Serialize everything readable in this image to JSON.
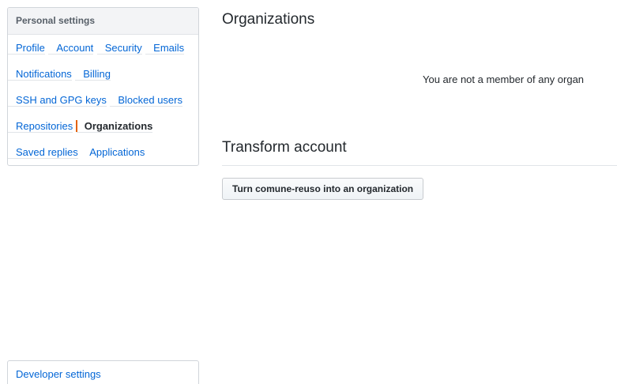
{
  "sidebar": {
    "heading": "Personal settings",
    "items": [
      {
        "label": "Profile",
        "selected": false
      },
      {
        "label": "Account",
        "selected": false
      },
      {
        "label": "Security",
        "selected": false
      },
      {
        "label": "Emails",
        "selected": false
      },
      {
        "label": "Notifications",
        "selected": false
      },
      {
        "label": "Billing",
        "selected": false
      },
      {
        "label": "SSH and GPG keys",
        "selected": false
      },
      {
        "label": "Blocked users",
        "selected": false
      },
      {
        "label": "Repositories",
        "selected": false
      },
      {
        "label": "Organizations",
        "selected": true
      },
      {
        "label": "Saved replies",
        "selected": false
      },
      {
        "label": "Applications",
        "selected": false
      }
    ],
    "developer_settings": "Developer settings"
  },
  "main": {
    "organizations_title": "Organizations",
    "empty_message": "You are not a member of any organ",
    "transform_title": "Transform account",
    "transform_button": "Turn comune-reuso into an organization"
  },
  "colors": {
    "link": "#0366d6",
    "selected_indicator": "#e36209",
    "text": "#24292e"
  }
}
